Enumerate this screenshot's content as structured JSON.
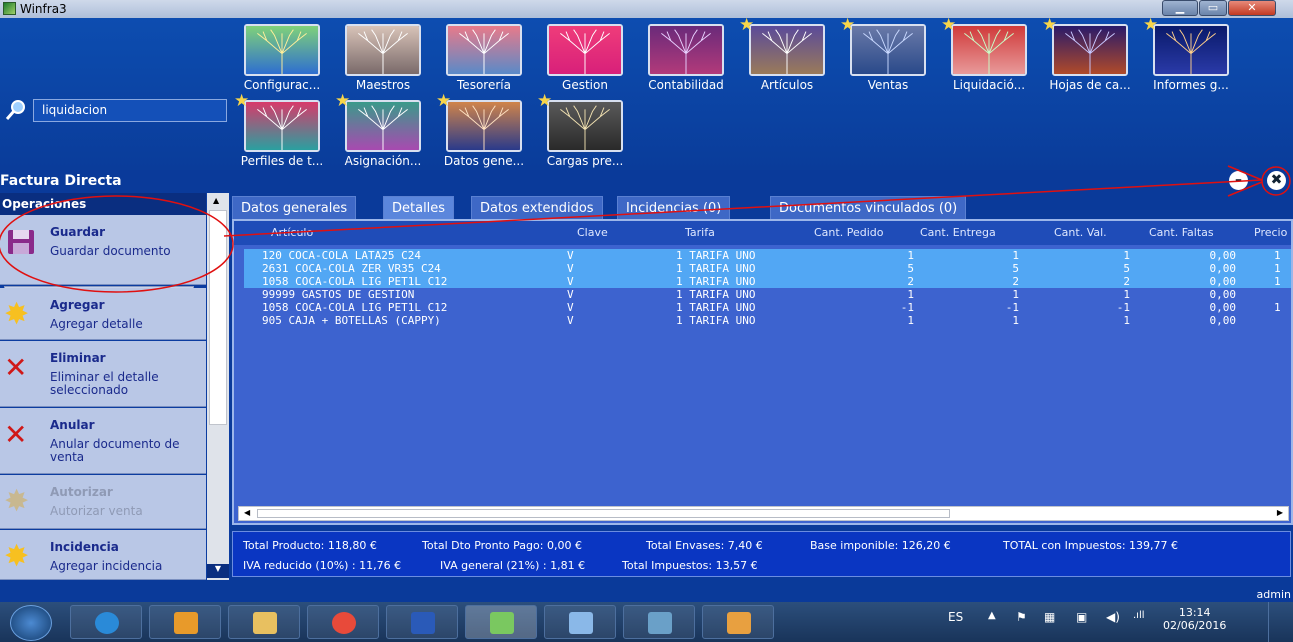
{
  "window": {
    "title": "Winfra3"
  },
  "search": {
    "value": "liquidacion"
  },
  "ribbon_row1": [
    {
      "label": "Configurac...",
      "starred": false
    },
    {
      "label": "Maestros",
      "starred": false
    },
    {
      "label": "Tesorería",
      "starred": false
    },
    {
      "label": "Gestion",
      "starred": false
    },
    {
      "label": "Contabilidad",
      "starred": false
    },
    {
      "label": "Artículos",
      "starred": true
    },
    {
      "label": "Ventas",
      "starred": true
    },
    {
      "label": "Liquidació...",
      "starred": true
    },
    {
      "label": "Hojas de ca...",
      "starred": true
    },
    {
      "label": "Informes g...",
      "starred": true
    }
  ],
  "ribbon_row2": [
    {
      "label": "Perfiles de t...",
      "starred": true
    },
    {
      "label": "Asignación...",
      "starred": true
    },
    {
      "label": "Datos gene...",
      "starred": true
    },
    {
      "label": "Cargas pre...",
      "starred": true
    }
  ],
  "form": {
    "title": "Factura Directa"
  },
  "operations": {
    "header": "Operaciones",
    "items": [
      {
        "title": "Guardar",
        "desc": "Guardar documento",
        "enabled": true,
        "icon": "floppy-disk-icon"
      },
      {
        "title": "Agregar",
        "desc": "Agregar detalle",
        "enabled": true,
        "icon": "sparkle-star-icon"
      },
      {
        "title": "Eliminar",
        "desc": "Eliminar el detalle seleccionado",
        "enabled": true,
        "icon": "red-x-icon"
      },
      {
        "title": "Anular",
        "desc": "Anular documento de venta",
        "enabled": true,
        "icon": "red-x-icon"
      },
      {
        "title": "Autorizar",
        "desc": "Autorizar venta",
        "enabled": false,
        "icon": "sparkle-star-icon"
      },
      {
        "title": "Incidencia",
        "desc": "Agregar incidencia",
        "enabled": true,
        "icon": "sparkle-star-icon"
      }
    ],
    "save_mode": "Solo guardar"
  },
  "tabs": [
    {
      "label": "Datos generales",
      "active": false
    },
    {
      "label": "Detalles",
      "active": true
    },
    {
      "label": "Datos extendidos",
      "active": false
    },
    {
      "label": "Incidencias (0)",
      "active": false
    },
    {
      "label": "Documentos vinculados (0)",
      "active": false
    }
  ],
  "grid": {
    "columns": [
      "Artículo",
      "Clave",
      "Tarifa",
      "Cant. Pedido",
      "Cant. Entrega",
      "Cant. Val.",
      "Cant. Faltas",
      "Precio"
    ],
    "rows": [
      {
        "articulo": "120 COCA-COLA LATA25 C24",
        "clave": "V",
        "tarifa": "1 TARIFA UNO",
        "pedido": "1",
        "entrega": "1",
        "val": "1",
        "faltas": "0,00",
        "precio": "1",
        "selected": true
      },
      {
        "articulo": "2631 COCA-COLA ZER VR35 C24",
        "clave": "V",
        "tarifa": "1 TARIFA UNO",
        "pedido": "5",
        "entrega": "5",
        "val": "5",
        "faltas": "0,00",
        "precio": "1",
        "selected": true
      },
      {
        "articulo": "1058 COCA-COLA LIG PET1L C12",
        "clave": "V",
        "tarifa": "1 TARIFA UNO",
        "pedido": "2",
        "entrega": "2",
        "val": "2",
        "faltas": "0,00",
        "precio": "1",
        "selected": true
      },
      {
        "articulo": "99999 GASTOS DE GESTION",
        "clave": "V",
        "tarifa": "1 TARIFA UNO",
        "pedido": "1",
        "entrega": "1",
        "val": "1",
        "faltas": "0,00",
        "precio": "",
        "selected": false
      },
      {
        "articulo": "1058 COCA-COLA LIG PET1L C12",
        "clave": "V",
        "tarifa": "1 TARIFA UNO",
        "pedido": "-1",
        "entrega": "-1",
        "val": "-1",
        "faltas": "0,00",
        "precio": "1",
        "selected": false
      },
      {
        "articulo": "905 CAJA + BOTELLAS (CAPPY)",
        "clave": "V",
        "tarifa": "1 TARIFA UNO",
        "pedido": "1",
        "entrega": "1",
        "val": "1",
        "faltas": "0,00",
        "precio": "",
        "selected": false
      }
    ]
  },
  "totals": {
    "total_producto": "Total Producto:  118,80 €",
    "dto_pronto_pago": "Total Dto Pronto Pago:  0,00 €",
    "total_envases": "Total Envases:  7,40 €",
    "base_imponible": "Base imponible:  126,20 €",
    "total_impuestos_full": "TOTAL con Impuestos:  139,77 €",
    "iva_reducido": "IVA reducido (10%) : 11,76 €",
    "iva_general": "IVA general (21%) : 1,81 €",
    "total_impuestos": "Total Impuestos: 13,57 €"
  },
  "user": "admin",
  "taskbar": {
    "lang": "ES",
    "time": "13:14",
    "date": "02/06/2016",
    "apps": [
      "internet-explorer-icon",
      "media-player-icon",
      "file-explorer-icon",
      "chrome-icon",
      "word-icon",
      "winfra-icon",
      "vector-tool-icon",
      "photos-icon",
      "paint-icon"
    ]
  },
  "colors": {
    "accent": "#0a3a9a",
    "selected_row": "#52a7f4",
    "grid_bg": "#3d63cf",
    "annotation_red": "#e01010"
  }
}
